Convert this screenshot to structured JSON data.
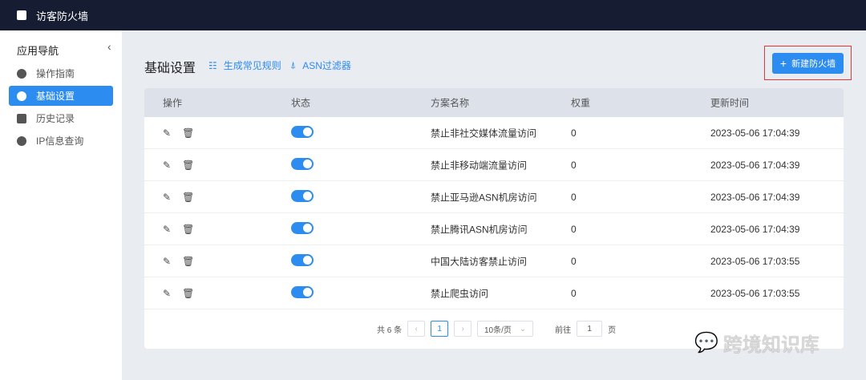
{
  "app": {
    "title": "访客防火墙"
  },
  "sidebar": {
    "title": "应用导航",
    "items": [
      {
        "label": "操作指南"
      },
      {
        "label": "基础设置"
      },
      {
        "label": "历史记录"
      },
      {
        "label": "IP信息查询"
      }
    ]
  },
  "page": {
    "title": "基础设置",
    "link_rules": "生成常见规则",
    "link_asn": "ASN过滤器",
    "new_button": "新建防火墙"
  },
  "table": {
    "columns": [
      "操作",
      "状态",
      "方案名称",
      "权重",
      "更新时间"
    ],
    "rows": [
      {
        "name": "禁止非社交媒体流量访问",
        "weight": "0",
        "updated": "2023-05-06 17:04:39",
        "enabled": true
      },
      {
        "name": "禁止非移动端流量访问",
        "weight": "0",
        "updated": "2023-05-06 17:04:39",
        "enabled": true
      },
      {
        "name": "禁止亚马逊ASN机房访问",
        "weight": "0",
        "updated": "2023-05-06 17:04:39",
        "enabled": true
      },
      {
        "name": "禁止腾讯ASN机房访问",
        "weight": "0",
        "updated": "2023-05-06 17:04:39",
        "enabled": true
      },
      {
        "name": "中国大陆访客禁止访问",
        "weight": "0",
        "updated": "2023-05-06 17:03:55",
        "enabled": true
      },
      {
        "name": "禁止爬虫访问",
        "weight": "0",
        "updated": "2023-05-06 17:03:55",
        "enabled": true
      }
    ]
  },
  "pagination": {
    "total": "共 6 条",
    "current": "1",
    "page_size": "10条/页",
    "goto_label": "前往",
    "goto_value": "1",
    "goto_suffix": "页"
  },
  "watermark": "跨境知识库"
}
